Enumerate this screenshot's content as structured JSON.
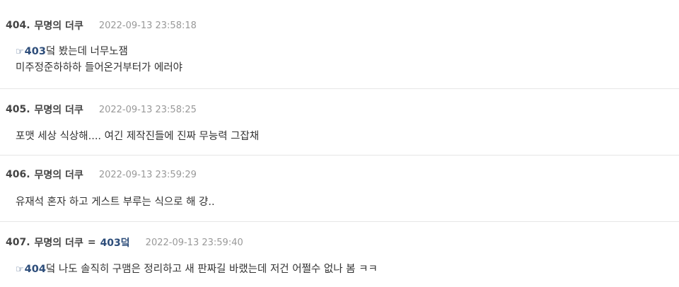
{
  "posts": [
    {
      "number": "404.",
      "author": "무명의 더쿠",
      "timestamp": "2022-09-13 23:58:18",
      "reply_icon": "☞",
      "reply_ref": "403",
      "reply_suffix": "덬 봤는데 너무노잼",
      "line2": "미주정준하하하 들어온거부터가 에러야"
    },
    {
      "number": "405.",
      "author": "무명의 더쿠",
      "timestamp": "2022-09-13 23:58:25",
      "line1": "포맷 세상 식상해.... 여긴 제작진들에 진짜 무능력 그잡채"
    },
    {
      "number": "406.",
      "author": "무명의 더쿠",
      "timestamp": "2022-09-13 23:59:29",
      "line1": "유재석 혼자 하고 게스트 부루는 식으로 해 걍.."
    },
    {
      "number": "407.",
      "author": "무명의 더쿠",
      "author_eq": "=",
      "author_ref": "403덬",
      "timestamp": "2022-09-13 23:59:40",
      "reply_icon": "☞",
      "reply_ref": "404",
      "reply_suffix": "덬 나도 솔직히 구맴은 정리하고 새 판짜길 바랬는데 저건 어쩔수 없나 봄 ㅋㅋ"
    }
  ]
}
